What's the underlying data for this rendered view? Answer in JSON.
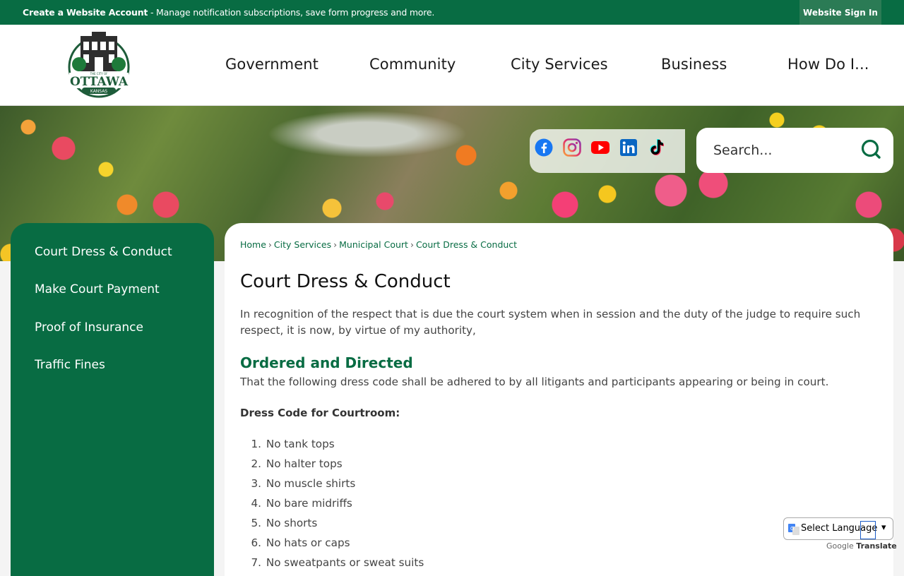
{
  "topbar": {
    "create_label": "Create a Website Account",
    "message": " - Manage notification subscriptions, save form progress and more.",
    "signin": "Website Sign In"
  },
  "logo": {
    "small": "THE CITY OF",
    "name": "OTTAWA",
    "state": "KANSAS",
    "color": "#1e5c3a"
  },
  "nav": {
    "items": [
      "Government",
      "Community",
      "City Services",
      "Business",
      "How Do I..."
    ]
  },
  "social": {
    "icons": [
      "facebook-icon",
      "instagram-icon",
      "youtube-icon",
      "linkedin-icon",
      "tiktok-icon"
    ]
  },
  "search": {
    "placeholder": "Search..."
  },
  "sidebar": {
    "items": [
      {
        "label": "Court Dress & Conduct"
      },
      {
        "label": "Make Court Payment"
      },
      {
        "label": "Proof of Insurance"
      },
      {
        "label": "Traffic Fines"
      }
    ]
  },
  "breadcrumb": {
    "items": [
      "Home",
      "City Services",
      "Municipal Court",
      "Court Dress & Conduct"
    ],
    "separator": "›"
  },
  "content": {
    "title": "Court Dress & Conduct",
    "intro": "In recognition of the respect that is due the court system when in session and the duty of the judge to require such respect, it is now, by virtue of my authority,",
    "subhead": "Ordered and Directed",
    "order_text": "That the following dress code shall be adhered to by all litigants and participants appearing or being in court.",
    "dress_head": "Dress Code for Courtroom:",
    "rules": [
      "No tank tops",
      "No halter tops",
      "No muscle shirts",
      "No bare midriffs",
      "No shorts",
      "No hats or caps",
      "No sweatpants or sweat suits"
    ]
  },
  "translate": {
    "label": "Select Language",
    "google": "Google",
    "translate": "Translate"
  },
  "colors": {
    "brand_green": "#086c43",
    "signin_bg": "#2b7b55"
  }
}
